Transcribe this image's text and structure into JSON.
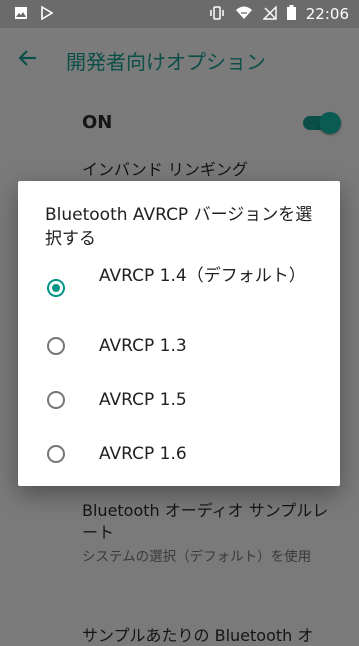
{
  "status_bar": {
    "time": "22:06",
    "icons": [
      "image-icon",
      "play-store-icon",
      "vibrate-icon",
      "wifi-icon",
      "no-signal-icon",
      "battery-icon"
    ]
  },
  "app_bar": {
    "title": "開発者向けオプション",
    "back_icon": "arrow-back-icon"
  },
  "master_switch": {
    "label": "ON",
    "state": "on"
  },
  "background_items": [
    {
      "title": "インバンド リンギング",
      "subtitle": ""
    },
    {
      "title": "Bluetooth オーディオ サンプルレート",
      "subtitle": "システムの選択（デフォルト）を使用"
    },
    {
      "title": "サンプルあたりの Bluetooth オ",
      "subtitle": ""
    }
  ],
  "dialog": {
    "title": "Bluetooth AVRCP バージョンを選択する",
    "options": [
      {
        "label": "AVRCP 1.4（デフォルト）",
        "selected": true
      },
      {
        "label": "AVRCP 1.3",
        "selected": false
      },
      {
        "label": "AVRCP 1.5",
        "selected": false
      },
      {
        "label": "AVRCP 1.6",
        "selected": false
      }
    ]
  },
  "colors": {
    "accent": "#009688",
    "title_dim": "#0a4f48",
    "scrim": "#7a7a7a"
  }
}
